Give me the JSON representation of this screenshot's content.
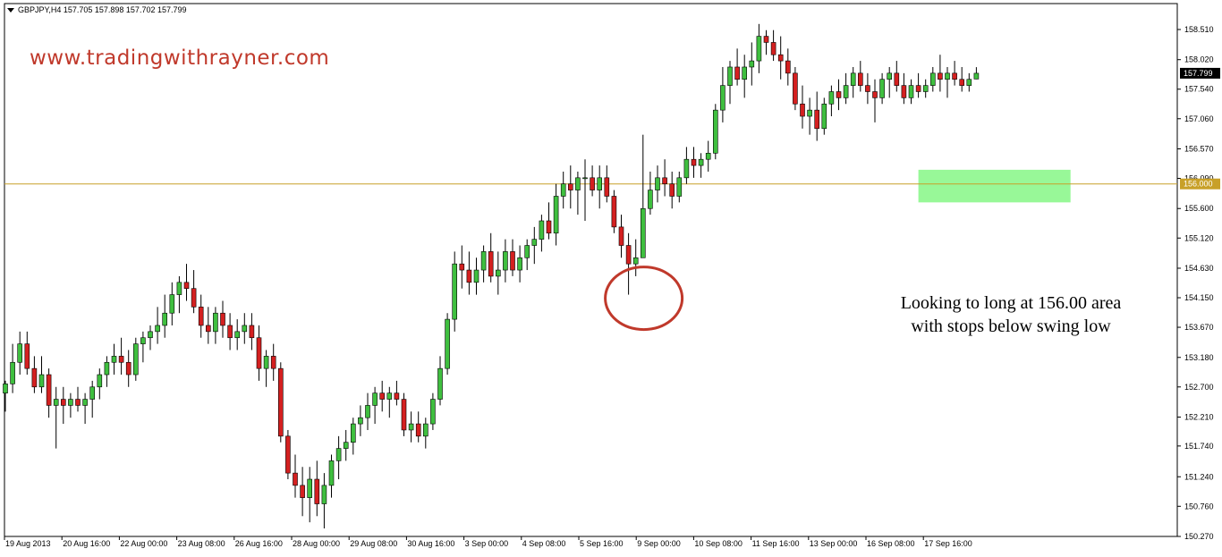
{
  "window": {
    "symbol_info": "GBPJPY,H4  157.705 157.898 157.702 157.799"
  },
  "watermark": "www.tradingwithrayner.com",
  "annotation": {
    "line1": "Looking to long at 156.00 area",
    "line2": "with stops below swing low"
  },
  "colors": {
    "bull": "#3fbf3f",
    "bear": "#d42020",
    "wick": "#000000",
    "level_line": "#c8a028",
    "level_label_bg": "#c8a028",
    "zone": "#98f898",
    "circle": "#c0392b",
    "grid_border": "#000000"
  },
  "chart_data": {
    "type": "candlestick",
    "timeframe": "H4",
    "ylim": [
      150.27,
      158.7
    ],
    "y_ticks": [
      "158.510",
      "158.020",
      "157.540",
      "157.060",
      "156.570",
      "156.090",
      "155.600",
      "155.120",
      "154.630",
      "154.150",
      "153.670",
      "153.180",
      "152.700",
      "152.210",
      "151.740",
      "151.240",
      "150.760",
      "150.270"
    ],
    "current_price_label": "157.799",
    "x_ticks": [
      "19 Aug 2013",
      "20 Aug 16:00",
      "22 Aug 00:00",
      "23 Aug 08:00",
      "26 Aug 16:00",
      "28 Aug 00:00",
      "29 Aug 08:00",
      "30 Aug 16:00",
      "3 Sep 00:00",
      "4 Sep 08:00",
      "5 Sep 16:00",
      "9 Sep 00:00",
      "10 Sep 08:00",
      "11 Sep 16:00",
      "13 Sep 00:00",
      "16 Sep 08:00",
      "17 Sep 16:00"
    ],
    "horizontal_level": {
      "value": 156.0,
      "label": "156.000"
    },
    "zone": {
      "from_value": 156.23,
      "to_value": 155.7,
      "start_index": 126,
      "end_index": 147
    },
    "highlight_circle": {
      "index": 86,
      "value": 154.2
    },
    "candles": [
      [
        152.6,
        152.8,
        152.3,
        152.75
      ],
      [
        152.75,
        153.4,
        152.6,
        153.1
      ],
      [
        153.1,
        153.6,
        152.9,
        153.4
      ],
      [
        153.4,
        153.6,
        152.9,
        153.0
      ],
      [
        153.0,
        153.2,
        152.6,
        152.7
      ],
      [
        152.7,
        153.2,
        152.6,
        152.9
      ],
      [
        152.9,
        153.0,
        152.2,
        152.4
      ],
      [
        152.4,
        152.7,
        151.7,
        152.5
      ],
      [
        152.5,
        152.7,
        152.1,
        152.4
      ],
      [
        152.4,
        152.6,
        152.2,
        152.5
      ],
      [
        152.5,
        152.7,
        152.3,
        152.4
      ],
      [
        152.4,
        152.6,
        152.1,
        152.5
      ],
      [
        152.5,
        152.8,
        152.2,
        152.7
      ],
      [
        152.7,
        153.0,
        152.5,
        152.9
      ],
      [
        152.9,
        153.2,
        152.7,
        153.1
      ],
      [
        153.1,
        153.4,
        152.9,
        153.2
      ],
      [
        153.2,
        153.5,
        152.9,
        153.1
      ],
      [
        153.1,
        153.3,
        152.7,
        152.9
      ],
      [
        152.9,
        153.5,
        152.8,
        153.4
      ],
      [
        153.4,
        153.6,
        153.1,
        153.5
      ],
      [
        153.5,
        153.7,
        153.3,
        153.6
      ],
      [
        153.6,
        154.0,
        153.4,
        153.7
      ],
      [
        153.7,
        154.2,
        153.5,
        153.9
      ],
      [
        153.9,
        154.4,
        153.7,
        154.2
      ],
      [
        154.2,
        154.5,
        153.9,
        154.4
      ],
      [
        154.4,
        154.7,
        154.1,
        154.3
      ],
      [
        154.3,
        154.6,
        153.9,
        154.0
      ],
      [
        154.0,
        154.2,
        153.5,
        153.7
      ],
      [
        153.7,
        154.0,
        153.4,
        153.6
      ],
      [
        153.6,
        154.0,
        153.4,
        153.9
      ],
      [
        153.9,
        154.1,
        153.5,
        153.7
      ],
      [
        153.7,
        153.9,
        153.3,
        153.5
      ],
      [
        153.5,
        153.8,
        153.3,
        153.6
      ],
      [
        153.6,
        153.9,
        153.4,
        153.7
      ],
      [
        153.7,
        153.9,
        153.3,
        153.5
      ],
      [
        153.5,
        153.7,
        152.8,
        153.0
      ],
      [
        153.0,
        153.3,
        152.7,
        153.2
      ],
      [
        153.2,
        153.4,
        152.8,
        153.0
      ],
      [
        153.0,
        153.1,
        151.8,
        151.9
      ],
      [
        151.9,
        152.0,
        151.2,
        151.3
      ],
      [
        151.3,
        151.6,
        150.9,
        151.1
      ],
      [
        151.1,
        151.4,
        150.6,
        150.9
      ],
      [
        150.9,
        151.4,
        150.5,
        151.2
      ],
      [
        151.2,
        151.5,
        150.6,
        150.8
      ],
      [
        150.8,
        151.3,
        150.4,
        151.1
      ],
      [
        151.1,
        151.6,
        150.9,
        151.5
      ],
      [
        151.5,
        151.9,
        151.2,
        151.7
      ],
      [
        151.7,
        152.0,
        151.5,
        151.8
      ],
      [
        151.8,
        152.2,
        151.6,
        152.1
      ],
      [
        152.1,
        152.4,
        151.9,
        152.2
      ],
      [
        152.2,
        152.6,
        152.0,
        152.4
      ],
      [
        152.4,
        152.7,
        152.1,
        152.6
      ],
      [
        152.6,
        152.8,
        152.3,
        152.5
      ],
      [
        152.5,
        152.7,
        152.2,
        152.6
      ],
      [
        152.6,
        152.8,
        152.4,
        152.5
      ],
      [
        152.5,
        152.6,
        151.9,
        152.0
      ],
      [
        152.0,
        152.3,
        151.8,
        152.1
      ],
      [
        152.1,
        152.3,
        151.8,
        151.9
      ],
      [
        151.9,
        152.2,
        151.7,
        152.1
      ],
      [
        152.1,
        152.6,
        152.0,
        152.5
      ],
      [
        152.5,
        153.2,
        152.4,
        153.0
      ],
      [
        153.0,
        153.9,
        152.9,
        153.8
      ],
      [
        153.8,
        154.9,
        153.6,
        154.7
      ],
      [
        154.7,
        155.0,
        154.3,
        154.6
      ],
      [
        154.6,
        154.9,
        154.2,
        154.4
      ],
      [
        154.4,
        154.8,
        154.2,
        154.6
      ],
      [
        154.6,
        155.0,
        154.4,
        154.9
      ],
      [
        154.9,
        155.2,
        154.4,
        154.5
      ],
      [
        154.5,
        154.9,
        154.2,
        154.6
      ],
      [
        154.6,
        155.1,
        154.4,
        154.9
      ],
      [
        154.9,
        155.1,
        154.5,
        154.6
      ],
      [
        154.6,
        155.0,
        154.4,
        154.8
      ],
      [
        154.8,
        155.1,
        154.6,
        155.0
      ],
      [
        155.0,
        155.3,
        154.7,
        155.1
      ],
      [
        155.1,
        155.5,
        154.9,
        155.4
      ],
      [
        155.4,
        155.7,
        155.1,
        155.2
      ],
      [
        155.2,
        156.0,
        155.0,
        155.8
      ],
      [
        155.8,
        156.2,
        155.6,
        156.0
      ],
      [
        156.0,
        156.3,
        155.6,
        155.9
      ],
      [
        155.9,
        156.2,
        155.5,
        156.1
      ],
      [
        156.1,
        156.4,
        155.4,
        156.1
      ],
      [
        156.1,
        156.3,
        155.8,
        155.9
      ],
      [
        155.9,
        156.3,
        155.6,
        156.1
      ],
      [
        156.1,
        156.3,
        155.7,
        155.8
      ],
      [
        155.8,
        155.9,
        155.2,
        155.3
      ],
      [
        155.3,
        155.5,
        154.8,
        155.0
      ],
      [
        155.0,
        155.2,
        154.2,
        154.7
      ],
      [
        154.7,
        155.1,
        154.5,
        154.8
      ],
      [
        154.8,
        156.8,
        155.3,
        155.6
      ],
      [
        155.6,
        156.2,
        155.5,
        155.9
      ],
      [
        155.9,
        156.3,
        155.7,
        156.1
      ],
      [
        156.1,
        156.4,
        155.8,
        156.0
      ],
      [
        156.0,
        156.2,
        155.6,
        155.8
      ],
      [
        155.8,
        156.2,
        155.7,
        156.1
      ],
      [
        156.1,
        156.6,
        156.0,
        156.4
      ],
      [
        156.4,
        156.6,
        156.1,
        156.3
      ],
      [
        156.3,
        156.5,
        156.1,
        156.4
      ],
      [
        156.4,
        156.7,
        156.2,
        156.5
      ],
      [
        156.5,
        157.3,
        156.4,
        157.2
      ],
      [
        157.2,
        157.9,
        157.0,
        157.6
      ],
      [
        157.6,
        158.0,
        157.3,
        157.9
      ],
      [
        157.9,
        158.2,
        157.6,
        157.7
      ],
      [
        157.7,
        158.1,
        157.4,
        157.9
      ],
      [
        157.9,
        158.3,
        157.6,
        158.0
      ],
      [
        158.0,
        158.6,
        157.8,
        158.4
      ],
      [
        158.4,
        158.5,
        158.1,
        158.3
      ],
      [
        158.3,
        158.5,
        158.0,
        158.1
      ],
      [
        158.1,
        158.4,
        157.7,
        158.0
      ],
      [
        158.0,
        158.2,
        157.6,
        157.8
      ],
      [
        157.8,
        157.9,
        157.2,
        157.3
      ],
      [
        157.3,
        157.6,
        156.9,
        157.1
      ],
      [
        157.1,
        157.4,
        156.8,
        157.2
      ],
      [
        157.2,
        157.5,
        156.7,
        156.9
      ],
      [
        156.9,
        157.4,
        156.8,
        157.3
      ],
      [
        157.3,
        157.6,
        157.1,
        157.5
      ],
      [
        157.5,
        157.7,
        157.2,
        157.4
      ],
      [
        157.4,
        157.8,
        157.3,
        157.6
      ],
      [
        157.6,
        157.9,
        157.4,
        157.8
      ],
      [
        157.8,
        158.0,
        157.5,
        157.6
      ],
      [
        157.6,
        157.8,
        157.3,
        157.5
      ],
      [
        157.5,
        157.7,
        157.0,
        157.4
      ],
      [
        157.4,
        157.8,
        157.3,
        157.7
      ],
      [
        157.7,
        157.9,
        157.4,
        157.8
      ],
      [
        157.8,
        158.0,
        157.5,
        157.6
      ],
      [
        157.6,
        157.8,
        157.3,
        157.4
      ],
      [
        157.4,
        157.7,
        157.3,
        157.6
      ],
      [
        157.6,
        157.8,
        157.4,
        157.5
      ],
      [
        157.5,
        157.7,
        157.4,
        157.6
      ],
      [
        157.6,
        157.9,
        157.5,
        157.8
      ],
      [
        157.8,
        158.1,
        157.5,
        157.7
      ],
      [
        157.7,
        157.9,
        157.4,
        157.8
      ],
      [
        157.8,
        158.0,
        157.6,
        157.7
      ],
      [
        157.7,
        157.9,
        157.5,
        157.6
      ],
      [
        157.6,
        157.8,
        157.5,
        157.7
      ],
      [
        157.705,
        157.898,
        157.702,
        157.799
      ]
    ]
  }
}
